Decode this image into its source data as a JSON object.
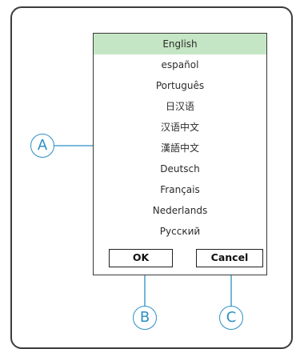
{
  "languages": [
    {
      "label": "English",
      "selected": true
    },
    {
      "label": "español",
      "selected": false
    },
    {
      "label": "Português",
      "selected": false
    },
    {
      "label": "日汉语",
      "selected": false
    },
    {
      "label": "汉语中文",
      "selected": false
    },
    {
      "label": "漢語中文",
      "selected": false
    },
    {
      "label": "Deutsch",
      "selected": false
    },
    {
      "label": "Français",
      "selected": false
    },
    {
      "label": "Nederlands",
      "selected": false
    },
    {
      "label": "Русский",
      "selected": false
    }
  ],
  "buttons": {
    "ok": "OK",
    "cancel": "Cancel"
  },
  "callouts": {
    "a": "A",
    "b": "B",
    "c": "C"
  },
  "colors": {
    "selected_bg": "#c5e6c5",
    "callout": "#2b8fc4"
  }
}
